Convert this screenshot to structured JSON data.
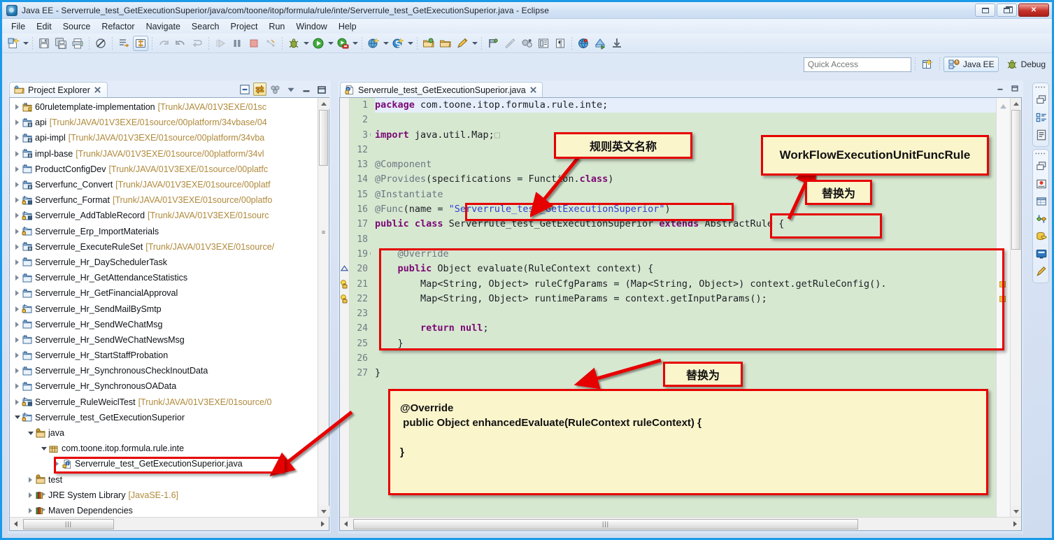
{
  "window": {
    "title": "Java EE - Serverrule_test_GetExecutionSuperior/java/com/toone/itop/formula/rule/inte/Serverrule_test_GetExecutionSuperior.java - Eclipse",
    "app_icon": "eclipse-icon",
    "buttons": {
      "minimize": "minimize",
      "restore": "restore",
      "close": "close"
    }
  },
  "menubar": {
    "items": [
      "File",
      "Edit",
      "Source",
      "Refactor",
      "Navigate",
      "Search",
      "Project",
      "Run",
      "Window",
      "Help"
    ]
  },
  "toolbar": {
    "groups": [
      {
        "items": [
          {
            "name": "new-wizard-icon",
            "glyph": "new"
          },
          {
            "name": "new-dropdown-arrow",
            "glyph": "arrow"
          }
        ]
      },
      {
        "items": [
          {
            "name": "save-icon",
            "glyph": "save"
          },
          {
            "name": "save-all-icon",
            "glyph": "saveall"
          },
          {
            "name": "print-icon",
            "glyph": "print"
          }
        ]
      },
      {
        "items": [
          {
            "name": "toggle-mark-occurrences-icon",
            "glyph": "occurrences"
          }
        ]
      },
      {
        "items": [
          {
            "name": "open-task-icon",
            "glyph": "task"
          },
          {
            "name": "link-editor-icon",
            "glyph": "linkeditor"
          }
        ]
      },
      {
        "items": [
          {
            "name": "next-annotation-icon",
            "glyph": "nextann"
          },
          {
            "name": "previous-annotation-icon",
            "glyph": "prevann"
          },
          {
            "name": "last-edit-location-icon",
            "glyph": "lastedit"
          }
        ]
      },
      {
        "items": [
          {
            "name": "resume-icon",
            "glyph": "resume"
          },
          {
            "name": "suspend-icon",
            "glyph": "suspend"
          },
          {
            "name": "terminate-icon",
            "glyph": "terminate"
          },
          {
            "name": "disconnect-icon",
            "glyph": "disconnect"
          }
        ]
      },
      {
        "items": [
          {
            "name": "debug-icon",
            "glyph": "debug"
          },
          {
            "name": "debug-dropdown-arrow",
            "glyph": "arrow"
          },
          {
            "name": "run-icon",
            "glyph": "run"
          },
          {
            "name": "run-dropdown-arrow",
            "glyph": "arrow"
          },
          {
            "name": "run-external-tools-icon",
            "glyph": "exttools"
          },
          {
            "name": "external-tools-dropdown-arrow",
            "glyph": "arrow"
          }
        ]
      },
      {
        "items": [
          {
            "name": "new-java-ee-project-icon",
            "glyph": "webproj"
          },
          {
            "name": "new-java-ee-project-arrow",
            "glyph": "arrow"
          },
          {
            "name": "new-server-icon",
            "glyph": "server"
          },
          {
            "name": "new-server-arrow",
            "glyph": "arrow"
          }
        ]
      },
      {
        "items": [
          {
            "name": "open-type-icon",
            "glyph": "opentype"
          },
          {
            "name": "open-task-folder-icon",
            "glyph": "folder"
          },
          {
            "name": "edit-icon",
            "glyph": "pencil"
          },
          {
            "name": "edit-dropdown-arrow",
            "glyph": "arrow"
          }
        ]
      },
      {
        "items": [
          {
            "name": "new-annotation-icon",
            "glyph": "annotation"
          },
          {
            "name": "ruler-icon",
            "glyph": "ruler"
          },
          {
            "name": "profile-icon",
            "glyph": "profile"
          },
          {
            "name": "show-view-icon",
            "glyph": "showview"
          },
          {
            "name": "paragraph-icon",
            "glyph": "paragraph"
          }
        ]
      },
      {
        "items": [
          {
            "name": "globe-icon",
            "glyph": "globe"
          },
          {
            "name": "publish-icon",
            "glyph": "publish"
          },
          {
            "name": "download-icon",
            "glyph": "download"
          }
        ]
      }
    ]
  },
  "quick_access": {
    "placeholder": "Quick Access",
    "value": "",
    "open_perspective_icon": "open-perspective-icon",
    "perspectives": [
      {
        "label": "Java EE",
        "icon": "java-ee-icon",
        "active": true
      },
      {
        "label": "Debug",
        "icon": "debug-perspective-icon",
        "active": false
      }
    ]
  },
  "project_explorer": {
    "tab_label": "Project Explorer",
    "tab_icon": "project-explorer-icon",
    "close_icon": "close-tab-icon",
    "toolbar": [
      {
        "name": "collapse-all-icon"
      },
      {
        "name": "link-with-editor-icon"
      },
      {
        "name": "view-menu-icon"
      },
      {
        "name": "view-dropdown-icon"
      },
      {
        "name": "minimize-view-icon"
      },
      {
        "name": "maximize-view-icon"
      }
    ],
    "tree": [
      {
        "indent": 0,
        "twist": "closed",
        "icon": "java-project-icon",
        "label": "60ruletemplate-implementation",
        "path": "[Trunk/JAVA/01V3EXE/01sc"
      },
      {
        "indent": 0,
        "twist": "closed",
        "icon": "maven-project-icon",
        "label": "api",
        "path": "[Trunk/JAVA/01V3EXE/01source/00platform/34vbase/04"
      },
      {
        "indent": 0,
        "twist": "closed",
        "icon": "maven-project-icon",
        "label": "api-impl",
        "path": "[Trunk/JAVA/01V3EXE/01source/00platform/34vba"
      },
      {
        "indent": 0,
        "twist": "closed",
        "icon": "maven-project-icon",
        "label": "impl-base",
        "path": "[Trunk/JAVA/01V3EXE/01source/00platform/34vl"
      },
      {
        "indent": 0,
        "twist": "closed",
        "icon": "project-icon",
        "label": "ProductConfigDev",
        "path": "[Trunk/JAVA/01V3EXE/01source/00platfc"
      },
      {
        "indent": 0,
        "twist": "closed",
        "icon": "maven-project-icon",
        "label": "Serverfunc_Convert",
        "path": "[Trunk/JAVA/01V3EXE/01source/00platf"
      },
      {
        "indent": 0,
        "twist": "closed",
        "icon": "maven-locked-project-icon",
        "label": "Serverfunc_Format",
        "path": "[Trunk/JAVA/01V3EXE/01source/00platfo"
      },
      {
        "indent": 0,
        "twist": "closed",
        "icon": "maven-locked-project-icon",
        "label": "Serverrule_AddTableRecord",
        "path": "[Trunk/JAVA/01V3EXE/01sourc"
      },
      {
        "indent": 0,
        "twist": "closed",
        "icon": "locked-project-icon",
        "label": "Serverrule_Erp_ImportMaterials",
        "path": ""
      },
      {
        "indent": 0,
        "twist": "closed",
        "icon": "maven-project-icon",
        "label": "Serverrule_ExecuteRuleSet",
        "path": "[Trunk/JAVA/01V3EXE/01source/"
      },
      {
        "indent": 0,
        "twist": "closed",
        "icon": "project-icon",
        "label": "Serverrule_Hr_DaySchedulerTask",
        "path": ""
      },
      {
        "indent": 0,
        "twist": "closed",
        "icon": "project-icon",
        "label": "Serverrule_Hr_GetAttendanceStatistics",
        "path": ""
      },
      {
        "indent": 0,
        "twist": "closed",
        "icon": "project-icon",
        "label": "Serverrule_Hr_GetFinancialApproval",
        "path": ""
      },
      {
        "indent": 0,
        "twist": "closed",
        "icon": "locked-project-icon",
        "label": "Serverrule_Hr_SendMailBySmtp",
        "path": ""
      },
      {
        "indent": 0,
        "twist": "closed",
        "icon": "project-icon",
        "label": "Serverrule_Hr_SendWeChatMsg",
        "path": ""
      },
      {
        "indent": 0,
        "twist": "closed",
        "icon": "project-icon",
        "label": "Serverrule_Hr_SendWeChatNewsMsg",
        "path": ""
      },
      {
        "indent": 0,
        "twist": "closed",
        "icon": "project-icon",
        "label": "Serverrule_Hr_StartStaffProbation",
        "path": ""
      },
      {
        "indent": 0,
        "twist": "closed",
        "icon": "project-icon",
        "label": "Serverrule_Hr_SynchronousCheckInoutData",
        "path": ""
      },
      {
        "indent": 0,
        "twist": "closed",
        "icon": "project-icon",
        "label": "Serverrule_Hr_SynchronousOAData",
        "path": ""
      },
      {
        "indent": 0,
        "twist": "closed",
        "icon": "maven-locked-project-icon",
        "label": "Serverrule_RuleWeiclTest",
        "path": "[Trunk/JAVA/01V3EXE/01source/0"
      },
      {
        "indent": 0,
        "twist": "open",
        "icon": "locked-project-icon",
        "label": "Serverrule_test_GetExecutionSuperior",
        "path": ""
      },
      {
        "indent": 1,
        "twist": "open",
        "icon": "source-folder-icon",
        "label": "java",
        "path": ""
      },
      {
        "indent": 2,
        "twist": "open",
        "icon": "package-icon",
        "label": "com.toone.itop.formula.rule.inte",
        "path": ""
      },
      {
        "indent": 3,
        "twist": "closed",
        "icon": "java-file-icon",
        "label": "Serverrule_test_GetExecutionSuperior.java",
        "path": "",
        "highlighted": true
      },
      {
        "indent": 1,
        "twist": "closed",
        "icon": "source-folder-icon",
        "label": "test",
        "path": ""
      },
      {
        "indent": 1,
        "twist": "closed",
        "icon": "library-icon",
        "label": "JRE System Library",
        "path": "[JavaSE-1.6]"
      },
      {
        "indent": 1,
        "twist": "closed",
        "icon": "library-icon",
        "label": "Maven Dependencies",
        "path": ""
      }
    ]
  },
  "editor": {
    "tab_label": "Serverrule_test_GetExecutionSuperior.java",
    "tab_icon": "java-file-icon",
    "close_icon": "close-tab-icon",
    "minimize_icon": "minimize-editor-icon",
    "maximize_icon": "maximize-editor-icon",
    "lines": [
      {
        "num": "1",
        "fold": "",
        "marker": "",
        "current": true,
        "tokens": [
          {
            "t": "kw",
            "s": "package"
          },
          {
            "t": "p",
            "s": " com.toone.itop.formula.rule.inte;"
          }
        ]
      },
      {
        "num": "2",
        "fold": "",
        "marker": "",
        "tokens": []
      },
      {
        "num": "3",
        "fold": "+",
        "marker": "",
        "tokens": [
          {
            "t": "kw",
            "s": "import"
          },
          {
            "t": "p",
            "s": " java.util.Map;"
          },
          {
            "t": "box",
            "s": "□"
          }
        ]
      },
      {
        "num": "12",
        "fold": "",
        "marker": "",
        "tokens": []
      },
      {
        "num": "13",
        "fold": "",
        "marker": "",
        "tokens": [
          {
            "t": "ann",
            "s": "@Component"
          }
        ]
      },
      {
        "num": "14",
        "fold": "",
        "marker": "",
        "tokens": [
          {
            "t": "ann",
            "s": "@Provides"
          },
          {
            "t": "p",
            "s": "(specifications = Function."
          },
          {
            "t": "kw",
            "s": "class"
          },
          {
            "t": "p",
            "s": ")"
          }
        ]
      },
      {
        "num": "15",
        "fold": "",
        "marker": "",
        "tokens": [
          {
            "t": "ann",
            "s": "@Instantiate"
          }
        ]
      },
      {
        "num": "16",
        "fold": "",
        "marker": "",
        "tokens": [
          {
            "t": "ann",
            "s": "@Func"
          },
          {
            "t": "p",
            "s": "(name = "
          },
          {
            "t": "str",
            "s": "\"Serverrule_test_GetExecutionSuperior\""
          },
          {
            "t": "p",
            "s": ")"
          }
        ]
      },
      {
        "num": "17",
        "fold": "",
        "marker": "",
        "tokens": [
          {
            "t": "kw",
            "s": "public class"
          },
          {
            "t": "p",
            "s": " Serverrule_test_GetExecutionSuperior "
          },
          {
            "t": "kw",
            "s": "extends"
          },
          {
            "t": "p",
            "s": " AbstractRule {"
          }
        ]
      },
      {
        "num": "18",
        "fold": "",
        "marker": "",
        "tokens": []
      },
      {
        "num": "19",
        "fold": "-",
        "marker": "",
        "tokens": [
          {
            "t": "p",
            "s": "    "
          },
          {
            "t": "ann",
            "s": "@Override"
          }
        ]
      },
      {
        "num": "20",
        "fold": "",
        "marker": "override-indicator",
        "tokens": [
          {
            "t": "p",
            "s": "    "
          },
          {
            "t": "kw",
            "s": "public"
          },
          {
            "t": "p",
            "s": " Object evaluate(RuleContext context) {"
          }
        ]
      },
      {
        "num": "21",
        "fold": "",
        "marker": "warning-bulb",
        "tokens": [
          {
            "t": "p",
            "s": "        Map<String, Object> ruleCfgParams = (Map<String, Object>) context.getRuleConfig()."
          }
        ]
      },
      {
        "num": "22",
        "fold": "",
        "marker": "warning-bulb",
        "tokens": [
          {
            "t": "p",
            "s": "        Map<String, Object> runtimeParams = context.getInputParams();"
          }
        ]
      },
      {
        "num": "23",
        "fold": "",
        "marker": "",
        "tokens": []
      },
      {
        "num": "24",
        "fold": "",
        "marker": "",
        "tokens": [
          {
            "t": "p",
            "s": "        "
          },
          {
            "t": "kw",
            "s": "return null"
          },
          {
            "t": "p",
            "s": ";"
          }
        ]
      },
      {
        "num": "25",
        "fold": "",
        "marker": "",
        "tokens": [
          {
            "t": "p",
            "s": "    }"
          }
        ]
      },
      {
        "num": "26",
        "fold": "",
        "marker": "",
        "tokens": []
      },
      {
        "num": "27",
        "fold": "",
        "marker": "",
        "tokens": [
          {
            "t": "p",
            "s": "}"
          }
        ]
      }
    ]
  },
  "annotations": {
    "callout_rule_name": {
      "text": "规则英文名称"
    },
    "callout_class_name": {
      "text": "WorkFlowExecutionUnitFuncRule"
    },
    "callout_replace_1": {
      "text": "替换为"
    },
    "callout_replace_2": {
      "text": "替换为"
    },
    "callout_code": {
      "lines": [
        "@Override",
        " public Object enhancedEvaluate(RuleContext ruleContext) {",
        "",
        "}"
      ]
    },
    "accent_color": "#e60000",
    "callout_bg": "#fbf5cc"
  },
  "fastview": {
    "groups": [
      {
        "items": [
          {
            "name": "restore-view-icon"
          },
          {
            "name": "outline-view-icon"
          },
          {
            "name": "task-list-view-icon"
          }
        ]
      },
      {
        "items": [
          {
            "name": "restore-view-icon"
          },
          {
            "name": "markers-view-icon"
          },
          {
            "name": "properties-view-icon"
          },
          {
            "name": "servers-view-icon"
          },
          {
            "name": "data-source-explorer-icon"
          },
          {
            "name": "console-view-icon"
          },
          {
            "name": "snippets-view-icon"
          }
        ]
      }
    ]
  }
}
